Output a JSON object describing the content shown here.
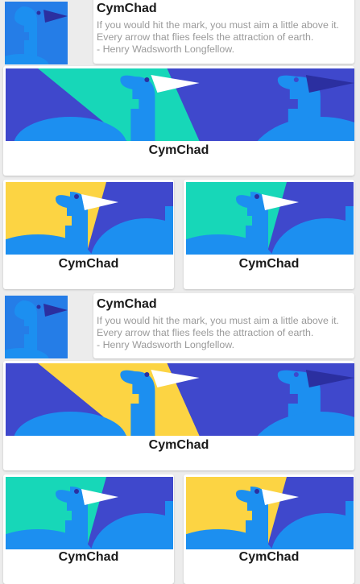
{
  "colors": {
    "page_bg": "#ececec",
    "card_bg": "#ffffff",
    "image_blue": "#3f48cc",
    "image_bird": "#1c8ff0",
    "image_teal": "#17d7b8",
    "image_yellow": "#fcd443",
    "beak_white": "#ffffff",
    "beak_navy": "#2b2fa0"
  },
  "items": [
    {
      "type": "text",
      "title": "CymChad",
      "quote": "If you would hit the mark, you must aim a little above it. Every arrow that flies feels the attraction of earth.",
      "author": " - Henry Wadsworth Longfellow."
    },
    {
      "type": "banner",
      "title": "CymChad"
    },
    {
      "type": "pair",
      "left": "CymChad",
      "right": "CymChad"
    },
    {
      "type": "text",
      "title": "CymChad",
      "quote": "If you would hit the mark, you must aim a little above it. Every arrow that flies feels the attraction of earth.",
      "author": " - Henry Wadsworth Longfellow."
    },
    {
      "type": "banner",
      "title": "CymChad"
    },
    {
      "type": "pair",
      "left": "CymChad",
      "right": "CymChad"
    }
  ]
}
